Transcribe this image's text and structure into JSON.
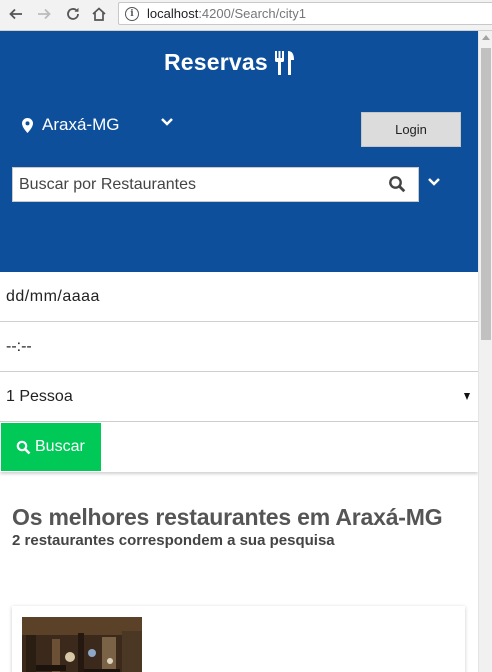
{
  "browser": {
    "url_host": "localhost",
    "url_path": ":4200/Search/city1",
    "icons": [
      "back-arrow-icon",
      "forward-arrow-icon",
      "reload-icon",
      "home-icon",
      "info-icon"
    ]
  },
  "header": {
    "brand": "Reservas",
    "brand_icon": "fork-knife-icon",
    "city": "Araxá-MG",
    "login_label": "Login",
    "search_placeholder": "Buscar por Restaurantes",
    "background": "#0e4f9c"
  },
  "form": {
    "date_value": "dd/mm/aaaa",
    "time_value": "--:--",
    "people_value": "1 Pessoa",
    "search_button": "Buscar",
    "search_button_color": "#00c957"
  },
  "results": {
    "title": "Os melhores restaurantes em Araxá-MG",
    "subtitle": "2 restaurantes correspondem a sua pesquisa"
  }
}
